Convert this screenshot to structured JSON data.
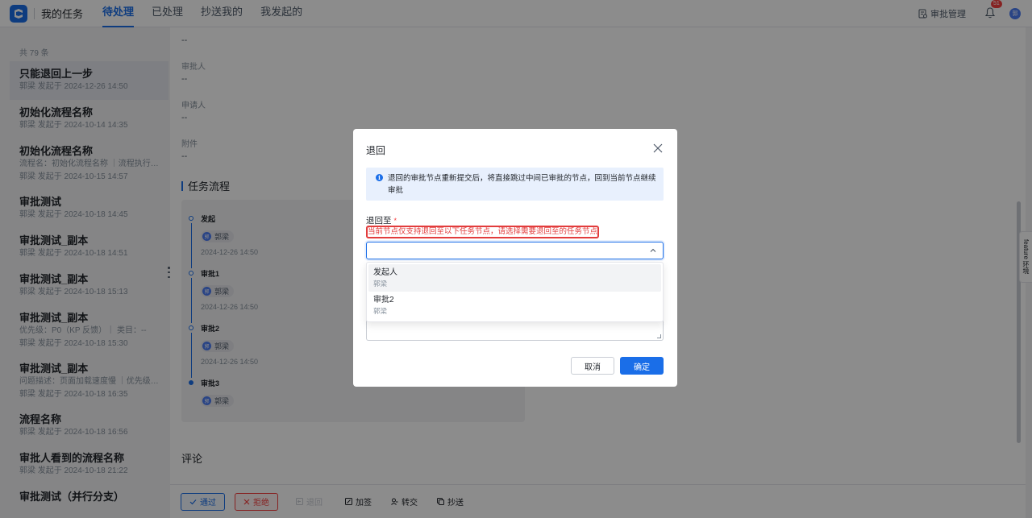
{
  "app": {
    "title": "我的任务"
  },
  "tabs": [
    {
      "label": "待处理",
      "active": true
    },
    {
      "label": "已处理",
      "active": false
    },
    {
      "label": "抄送我的",
      "active": false
    },
    {
      "label": "我发起的",
      "active": false
    }
  ],
  "header_right": {
    "approval_mgmt": "审批管理",
    "notification_count": "51",
    "avatar_initial": "郭"
  },
  "task_list": {
    "total": "共 79 条",
    "items": [
      {
        "title": "只能退回上一步",
        "meta": [
          "郭梁 发起于 2024-12-26 14:50"
        ],
        "selected": true
      },
      {
        "title": "初始化流程名称",
        "meta": [
          "郭梁 发起于 2024-10-14 14:35"
        ]
      },
      {
        "title": "初始化流程名称",
        "meta": [
          "流程名：初始化流程名称 ｜流程执行 ID：...",
          "郭梁 发起于 2024-10-15 14:57"
        ]
      },
      {
        "title": "审批测试",
        "meta": [
          "郭梁 发起于 2024-10-18 14:45"
        ]
      },
      {
        "title": "审批测试_副本",
        "meta": [
          "郭梁 发起于 2024-10-18 14:51"
        ]
      },
      {
        "title": "审批测试_副本",
        "meta": [
          "郭梁 发起于 2024-10-18 15:13"
        ]
      },
      {
        "title": "审批测试_副本",
        "meta": [
          "优先级：P0（KP 反馈）｜ 类目：--",
          "郭梁 发起于 2024-10-18 15:30"
        ]
      },
      {
        "title": "审批测试_副本",
        "meta": [
          "问题描述：页面加载速度慢 ｜优先级：P1...",
          "郭梁 发起于 2024-10-18 16:35"
        ]
      },
      {
        "title": "流程名称",
        "meta": [
          "郭梁 发起于 2024-10-18 16:56"
        ]
      },
      {
        "title": "审批人看到的流程名称",
        "meta": [
          "郭梁 发起于 2024-10-18 21:22"
        ]
      },
      {
        "title": "审批测试（并行分支）",
        "meta": [
          ""
        ]
      }
    ]
  },
  "detail": {
    "fields": [
      {
        "label": "",
        "value": "--"
      },
      {
        "label": "审批人",
        "value": "--"
      },
      {
        "label": "申请人",
        "value": "--"
      },
      {
        "label": "附件",
        "value": "--"
      }
    ],
    "flow_title": "任务流程",
    "flow_nodes": [
      {
        "title": "发起",
        "person": "郭梁",
        "time": "2024-12-26 14:50"
      },
      {
        "title": "审批1",
        "person": "郭梁",
        "time": "2024-12-26 14:50"
      },
      {
        "title": "审批2",
        "person": "郭梁",
        "time": "2024-12-26 14:50"
      },
      {
        "title": "审批3",
        "person": "郭梁",
        "time": ""
      }
    ],
    "comment_title": "评论",
    "actions": {
      "pass": "通过",
      "reject": "拒绝",
      "return": "退回",
      "add_sign": "加签",
      "transfer": "转交",
      "cc": "抄送"
    }
  },
  "side_tab": "feature 环境",
  "modal": {
    "title": "退回",
    "info": "退回的审批节点重新提交后，将直接跳过中间已审批的节点，回到当前节点继续审批",
    "field_label": "退回至",
    "required_mark": "*",
    "hint": "当前节点仅支持退回至以下任务节点，请选择需要退回至的任务节点",
    "select_value": "",
    "options": [
      {
        "title": "发起人",
        "sub": "郭梁",
        "hovered": true
      },
      {
        "title": "审批2",
        "sub": "郭梁",
        "hovered": false
      }
    ],
    "cancel": "取消",
    "confirm": "确定"
  }
}
